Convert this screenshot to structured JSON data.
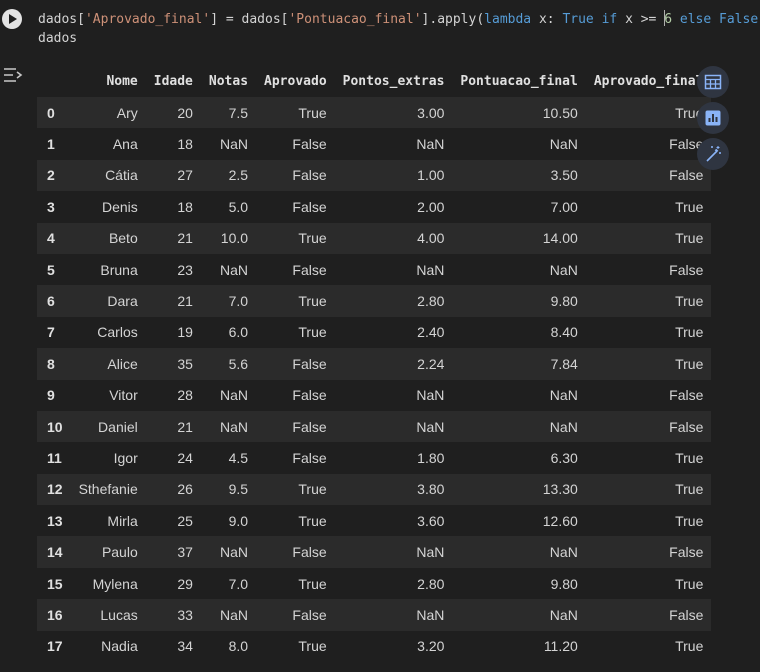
{
  "code": {
    "line1": {
      "p1": "dados[",
      "s1": "'Aprovado_final'",
      "p2": "] = dados[",
      "s2": "'Pontuacao_final'",
      "p3": "].apply(",
      "k1": "lambda",
      "p4": " x: ",
      "k2": "True",
      "p5": " ",
      "k3": "if",
      "p6": " x >= ",
      "n1": "6",
      "p7": " ",
      "k4": "else",
      "p8": " ",
      "k5": "False",
      "p9": ")"
    },
    "line2": "dados"
  },
  "table": {
    "columns": [
      "",
      "Nome",
      "Idade",
      "Notas",
      "Aprovado",
      "Pontos_extras",
      "Pontuacao_final",
      "Aprovado_final"
    ],
    "rows": [
      [
        "0",
        "Ary",
        "20",
        "7.5",
        "True",
        "3.00",
        "10.50",
        "True"
      ],
      [
        "1",
        "Ana",
        "18",
        "NaN",
        "False",
        "NaN",
        "NaN",
        "False"
      ],
      [
        "2",
        "Cátia",
        "27",
        "2.5",
        "False",
        "1.00",
        "3.50",
        "False"
      ],
      [
        "3",
        "Denis",
        "18",
        "5.0",
        "False",
        "2.00",
        "7.00",
        "True"
      ],
      [
        "4",
        "Beto",
        "21",
        "10.0",
        "True",
        "4.00",
        "14.00",
        "True"
      ],
      [
        "5",
        "Bruna",
        "23",
        "NaN",
        "False",
        "NaN",
        "NaN",
        "False"
      ],
      [
        "6",
        "Dara",
        "21",
        "7.0",
        "True",
        "2.80",
        "9.80",
        "True"
      ],
      [
        "7",
        "Carlos",
        "19",
        "6.0",
        "True",
        "2.40",
        "8.40",
        "True"
      ],
      [
        "8",
        "Alice",
        "35",
        "5.6",
        "False",
        "2.24",
        "7.84",
        "True"
      ],
      [
        "9",
        "Vitor",
        "28",
        "NaN",
        "False",
        "NaN",
        "NaN",
        "False"
      ],
      [
        "10",
        "Daniel",
        "21",
        "NaN",
        "False",
        "NaN",
        "NaN",
        "False"
      ],
      [
        "11",
        "Igor",
        "24",
        "4.5",
        "False",
        "1.80",
        "6.30",
        "True"
      ],
      [
        "12",
        "Sthefanie",
        "26",
        "9.5",
        "True",
        "3.80",
        "13.30",
        "True"
      ],
      [
        "13",
        "Mirla",
        "25",
        "9.0",
        "True",
        "3.60",
        "12.60",
        "True"
      ],
      [
        "14",
        "Paulo",
        "37",
        "NaN",
        "False",
        "NaN",
        "NaN",
        "False"
      ],
      [
        "15",
        "Mylena",
        "29",
        "7.0",
        "True",
        "2.80",
        "9.80",
        "True"
      ],
      [
        "16",
        "Lucas",
        "33",
        "NaN",
        "False",
        "NaN",
        "NaN",
        "False"
      ],
      [
        "17",
        "Nadia",
        "34",
        "8.0",
        "True",
        "3.20",
        "11.20",
        "True"
      ]
    ]
  },
  "icons": {
    "run": "play-circle-icon",
    "output_toggle": "output-settings-icon",
    "table": "table-icon",
    "chart": "bar-chart-icon",
    "magic": "magic-wand-icon"
  },
  "colors": {
    "background": "#1f1f1f",
    "row_stripe": "#2b2b2b",
    "string": "#ce9178",
    "keyword": "#569cd6",
    "number": "#b5cea8",
    "action_button": "#2f3541",
    "action_icon": "#8ab4f8"
  }
}
